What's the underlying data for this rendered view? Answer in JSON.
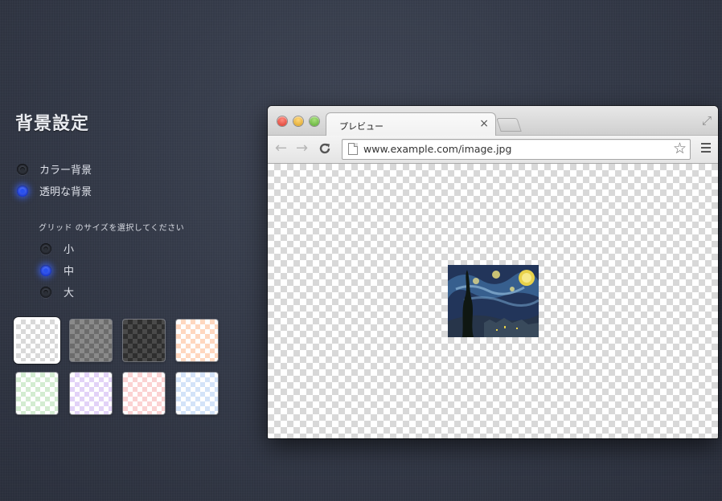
{
  "settings": {
    "title": "背景設定",
    "background_options": [
      {
        "label": "カラー背景",
        "selected": false
      },
      {
        "label": "透明な背景",
        "selected": true
      }
    ],
    "grid_size_label": "グリッド のサイズを選択してください",
    "grid_sizes": [
      {
        "label": "小",
        "selected": false
      },
      {
        "label": "中",
        "selected": true
      },
      {
        "label": "大",
        "selected": false
      }
    ],
    "swatches": [
      {
        "name": "white-gray",
        "color_a": "#ffffff",
        "color_b": "#d9d9d9",
        "selected": true
      },
      {
        "name": "gray",
        "color_a": "#8a8a8a",
        "color_b": "#6c6c6c",
        "selected": false
      },
      {
        "name": "dark",
        "color_a": "#4a4a4a",
        "color_b": "#2f2f2f",
        "selected": false
      },
      {
        "name": "orange",
        "color_a": "#ffffff",
        "color_b": "#ffd7bf",
        "selected": false
      },
      {
        "name": "green",
        "color_a": "#ffffff",
        "color_b": "#d3ecd1",
        "selected": false
      },
      {
        "name": "purple",
        "color_a": "#ffffff",
        "color_b": "#e2d2f7",
        "selected": false
      },
      {
        "name": "pink",
        "color_a": "#ffffff",
        "color_b": "#fbd2d2",
        "selected": false
      },
      {
        "name": "blue",
        "color_a": "#ffffff",
        "color_b": "#d3e3f8",
        "selected": false
      }
    ],
    "accent_color": "#2850f0"
  },
  "browser": {
    "tab_title": "プレビュー",
    "tab_close": "×",
    "url": "www.example.com/image.jpg",
    "back_icon": "←",
    "forward_icon": "→",
    "reload_icon": "C",
    "star_icon": "☆",
    "fullscreen_icon": "⤢"
  }
}
